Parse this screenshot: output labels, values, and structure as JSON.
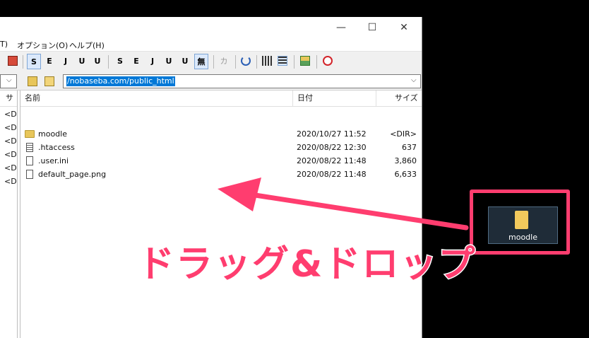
{
  "window": {
    "menu": [
      "T)",
      "オプション(O)",
      "ヘルプ(H)"
    ],
    "controls": {
      "minimize": "—",
      "maximize": "☐",
      "close": "✕"
    }
  },
  "toolbar": {
    "buttons": [
      "S",
      "E",
      "J",
      "U",
      "U",
      "S",
      "E",
      "J",
      "U",
      "U",
      "無",
      "カナ"
    ]
  },
  "address": {
    "path": "/nobaseba.com/public_html"
  },
  "file_list": {
    "columns": {
      "name": "名前",
      "date": "日付",
      "size": "サイズ"
    },
    "left_column_header": "サ",
    "left_values": [
      "<D",
      "<D",
      "<D",
      "<D",
      "<D",
      "<D"
    ],
    "rows": [
      {
        "name": "moodle",
        "date": "2020/10/27 11:52",
        "size": "<DIR>",
        "type": "folder"
      },
      {
        "name": ".htaccess",
        "date": "2020/08/22 12:30",
        "size": "637",
        "type": "file-text"
      },
      {
        "name": ".user.ini",
        "date": "2020/08/22 11:48",
        "size": "3,860",
        "type": "file"
      },
      {
        "name": "default_page.png",
        "date": "2020/08/22 11:48",
        "size": "6,633",
        "type": "file"
      }
    ]
  },
  "desktop": {
    "folder_label": "moodle"
  },
  "annotation": {
    "text": "ドラッグ&ドロップ",
    "color": "#ff3d6f"
  }
}
